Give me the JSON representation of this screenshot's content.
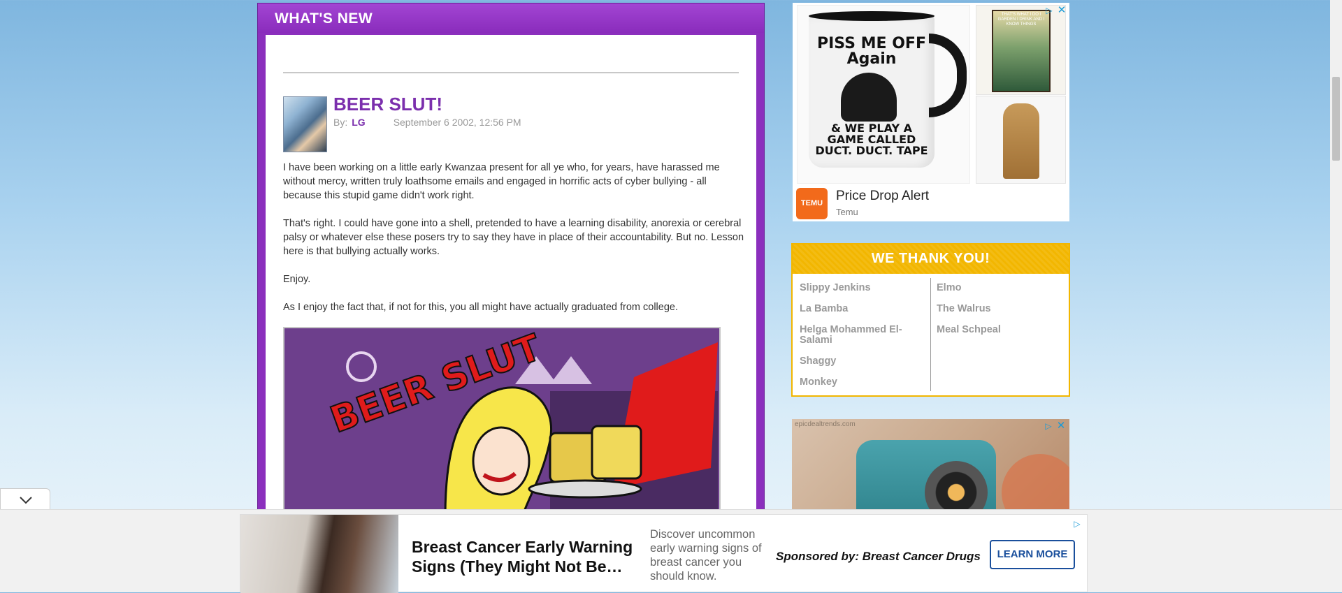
{
  "main": {
    "header_title": "WHAT'S NEW",
    "post": {
      "title": "BEER SLUT!",
      "by_label": "By:",
      "author": "LG",
      "date": "September 6 2002, 12:56 PM",
      "paragraphs": [
        "I have been working on a little early Kwanzaa present for all ye who, for years, have harassed me without mercy, written truly loathsome emails and engaged in horrific acts of cyber bullying - all because this stupid game didn't work right.",
        "That's right. I could have gone into a shell, pretended to have a learning disability, anorexia or cerebral palsy or whatever else these posers try to say they have in place of their accountability. But no. Lesson here is that bullying actually works.",
        "Enjoy.",
        "As I enjoy the fact that, if not for this, you all might have actually graduated from college."
      ],
      "image_text": "BEER SLUT"
    }
  },
  "ad_temu": {
    "mug_text_top": "PISS ME OFF Again",
    "mug_text_bottom": "& WE PLAY A GAME CALLED DUCT. DUCT. TAPE",
    "thumb1_text": "THAT'S WHAT I DO I GARDEN I DRINK AND I KNOW THINGS",
    "logo_text": "TEMU",
    "title": "Price Drop Alert",
    "brand": "Temu"
  },
  "thanks": {
    "header": "WE THANK YOU!",
    "left": [
      "Slippy Jenkins",
      "La Bamba",
      "Helga Mohammed El-Salami",
      "Shaggy",
      "Monkey"
    ],
    "right": [
      "Elmo",
      "The Walrus",
      "Meal Schpeal"
    ]
  },
  "ad_camera": {
    "source": "epicdealtrends.com"
  },
  "bottom_ad": {
    "headline": "Breast Cancer Early Warning Signs (They Might Not Be…",
    "description": "Discover uncommon early warning signs of breast cancer you should know.",
    "sponsor": "Sponsored by: Breast Cancer Drugs",
    "cta": "LEARN MORE"
  },
  "colors": {
    "purple": "#8b2fbd",
    "title_purple": "#7b2fad",
    "gold": "#f2b600",
    "adchoice_blue": "#1a9bd7"
  },
  "icons": {
    "collapse": "chevron-down-icon",
    "adchoices": "adchoices-icon",
    "close": "close-icon"
  }
}
